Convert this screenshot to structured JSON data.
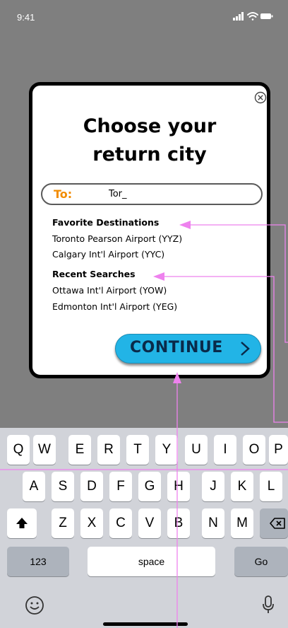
{
  "status_bar": {
    "time": "9:41",
    "icons": [
      "cellular-signal-icon",
      "wifi-icon",
      "battery-icon"
    ]
  },
  "modal": {
    "title_line1": "Choose your",
    "title_line2": "return city",
    "close_icon": "close-circle-icon",
    "to_field": {
      "label": "To:",
      "value": "Tor_"
    },
    "favorites": {
      "heading": "Favorite Destinations",
      "items": [
        "Toronto Pearson Airport (YYZ)",
        "Calgary Int'l Airport (YYC)"
      ]
    },
    "recents": {
      "heading": "Recent Searches",
      "items": [
        "Ottawa Int'l Airport (YOW)",
        "Edmonton Int'l Airport (YEG)"
      ]
    },
    "continue_label": "CONTINUE"
  },
  "keyboard": {
    "row1": [
      "Q",
      "W",
      "E",
      "R",
      "T",
      "Y",
      "U",
      "I",
      "O",
      "P"
    ],
    "row2": [
      "A",
      "S",
      "D",
      "F",
      "G",
      "H",
      "J",
      "K",
      "L"
    ],
    "row3": [
      "Z",
      "X",
      "C",
      "V",
      "B",
      "N",
      "M"
    ],
    "numbers_label": "123",
    "space_label": "space",
    "go_label": "Go",
    "shift_icon": "shift-arrow-icon",
    "backspace_icon": "backspace-icon",
    "emoji_icon": "emoji-icon",
    "mic_icon": "microphone-icon"
  },
  "colors": {
    "backdrop": "#7f7f7f",
    "to_label": "#f28c00",
    "continue_button": "#22b4e6",
    "continue_text": "#0a2a4a",
    "annotation": "#ee82ee",
    "keyboard_bg": "#d1d3d9"
  }
}
